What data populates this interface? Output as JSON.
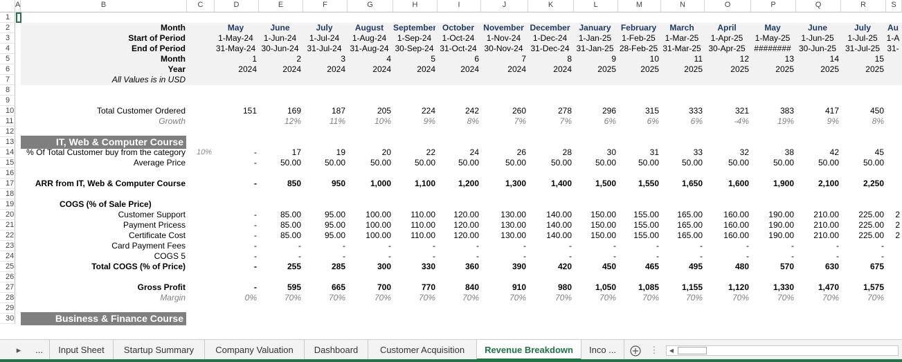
{
  "columns": [
    "A",
    "B",
    "C",
    "D",
    "E",
    "F",
    "G",
    "H",
    "I",
    "J",
    "K",
    "L",
    "M",
    "N",
    "O",
    "P",
    "Q",
    "R",
    "S"
  ],
  "header": {
    "labels": [
      "Month",
      "Start of Period",
      "End of Period",
      "Month",
      "Year"
    ],
    "note": "All Values is in USD",
    "months": [
      "May",
      "June",
      "July",
      "August",
      "September",
      "October",
      "November",
      "December",
      "January",
      "February",
      "March",
      "April",
      "May",
      "June",
      "July",
      "Au"
    ],
    "start": [
      "1-May-24",
      "1-Jun-24",
      "1-Jul-24",
      "1-Aug-24",
      "1-Sep-24",
      "1-Oct-24",
      "1-Nov-24",
      "1-Dec-24",
      "1-Jan-25",
      "1-Feb-25",
      "1-Mar-25",
      "1-Apr-25",
      "1-May-25",
      "1-Jun-25",
      "1-Jul-25",
      "1-A"
    ],
    "end": [
      "31-May-24",
      "30-Jun-24",
      "31-Jul-24",
      "31-Aug-24",
      "30-Sep-24",
      "31-Oct-24",
      "30-Nov-24",
      "31-Dec-24",
      "31-Jan-25",
      "28-Feb-25",
      "31-Mar-25",
      "30-Apr-25",
      "########",
      "30-Jun-25",
      "31-Jul-25",
      "31-"
    ],
    "month_num": [
      "1",
      "2",
      "3",
      "4",
      "5",
      "6",
      "7",
      "8",
      "9",
      "10",
      "11",
      "12",
      "13",
      "14",
      "15",
      ""
    ],
    "year": [
      "2024",
      "2024",
      "2024",
      "2024",
      "2024",
      "2024",
      "2024",
      "2024",
      "2025",
      "2025",
      "2025",
      "2025",
      "2025",
      "2025",
      "2025",
      ""
    ]
  },
  "rows": {
    "total_customer": {
      "label": "Total Customer Ordered",
      "values": [
        "151",
        "169",
        "187",
        "205",
        "224",
        "242",
        "260",
        "278",
        "296",
        "315",
        "333",
        "321",
        "383",
        "417",
        "450"
      ]
    },
    "growth": {
      "label": "Growth",
      "values": [
        "",
        "12%",
        "11%",
        "10%",
        "9%",
        "8%",
        "7%",
        "7%",
        "6%",
        "6%",
        "6%",
        "-4%",
        "19%",
        "9%",
        "8%"
      ]
    },
    "section1": "IT, Web & Computer Course",
    "pct_buy": {
      "label": "% Of Total Customer buy from the category",
      "input": "10%",
      "values": [
        "-",
        "17",
        "19",
        "20",
        "22",
        "24",
        "26",
        "28",
        "30",
        "31",
        "33",
        "32",
        "38",
        "42",
        "45"
      ]
    },
    "avg_price": {
      "label": "Average Price",
      "values": [
        "-",
        "50.00",
        "50.00",
        "50.00",
        "50.00",
        "50.00",
        "50.00",
        "50.00",
        "50.00",
        "50.00",
        "50.00",
        "50.00",
        "50.00",
        "50.00",
        "50.00"
      ]
    },
    "arr": {
      "label": "ARR from IT, Web & Computer Course",
      "values": [
        "-",
        "850",
        "950",
        "1,000",
        "1,100",
        "1,200",
        "1,300",
        "1,400",
        "1,500",
        "1,550",
        "1,650",
        "1,600",
        "1,900",
        "2,100",
        "2,250"
      ]
    },
    "cogs_title": "COGS (% of Sale Price)",
    "customer_support": {
      "label": "Customer Support",
      "values": [
        "-",
        "85.00",
        "95.00",
        "100.00",
        "110.00",
        "120.00",
        "130.00",
        "140.00",
        "150.00",
        "155.00",
        "165.00",
        "160.00",
        "190.00",
        "210.00",
        "225.00",
        "2"
      ]
    },
    "payment_process": {
      "label": "Payment Pricess",
      "values": [
        "-",
        "85.00",
        "95.00",
        "100.00",
        "110.00",
        "120.00",
        "130.00",
        "140.00",
        "150.00",
        "155.00",
        "165.00",
        "160.00",
        "190.00",
        "210.00",
        "225.00",
        "2"
      ]
    },
    "certificate_cost": {
      "label": "Certificate Cost",
      "values": [
        "-",
        "85.00",
        "95.00",
        "100.00",
        "110.00",
        "120.00",
        "130.00",
        "140.00",
        "150.00",
        "155.00",
        "165.00",
        "160.00",
        "190.00",
        "210.00",
        "225.00",
        "2"
      ]
    },
    "card_fees": {
      "label": "Card Payment Fees",
      "values": [
        "-",
        "-",
        "-",
        "-",
        "-",
        "-",
        "-",
        "-",
        "-",
        "-",
        "-",
        "-",
        "-",
        "-",
        "-"
      ]
    },
    "cogs5": {
      "label": "COGS 5",
      "values": [
        "-",
        "-",
        "-",
        "-",
        "-",
        "-",
        "-",
        "-",
        "-",
        "-",
        "-",
        "-",
        "-",
        "-",
        "-"
      ]
    },
    "total_cogs": {
      "label": "Total COGS (% of Price)",
      "values": [
        "-",
        "255",
        "285",
        "300",
        "330",
        "360",
        "390",
        "420",
        "450",
        "465",
        "495",
        "480",
        "570",
        "630",
        "675"
      ]
    },
    "gross_profit": {
      "label": "Gross Profit",
      "values": [
        "-",
        "595",
        "665",
        "700",
        "770",
        "840",
        "910",
        "980",
        "1,050",
        "1,085",
        "1,155",
        "1,120",
        "1,330",
        "1,470",
        "1,575"
      ]
    },
    "margin": {
      "label": "Margin",
      "values": [
        "0%",
        "70%",
        "70%",
        "70%",
        "70%",
        "70%",
        "70%",
        "70%",
        "70%",
        "70%",
        "70%",
        "70%",
        "70%",
        "70%",
        "70%"
      ]
    },
    "section2": "Business & Finance Course"
  },
  "tabs": {
    "more_left": "...",
    "items": [
      "Input Sheet",
      "Startup Summary",
      "Company Valuation",
      "Dashboard",
      "Customer Acquisition",
      "Revenue Breakdown",
      "Inco ..."
    ],
    "active": "Revenue Breakdown"
  },
  "colors": {
    "accent": "#217346",
    "section_bg": "#7f7f7f",
    "header_text": "#1f3864"
  }
}
